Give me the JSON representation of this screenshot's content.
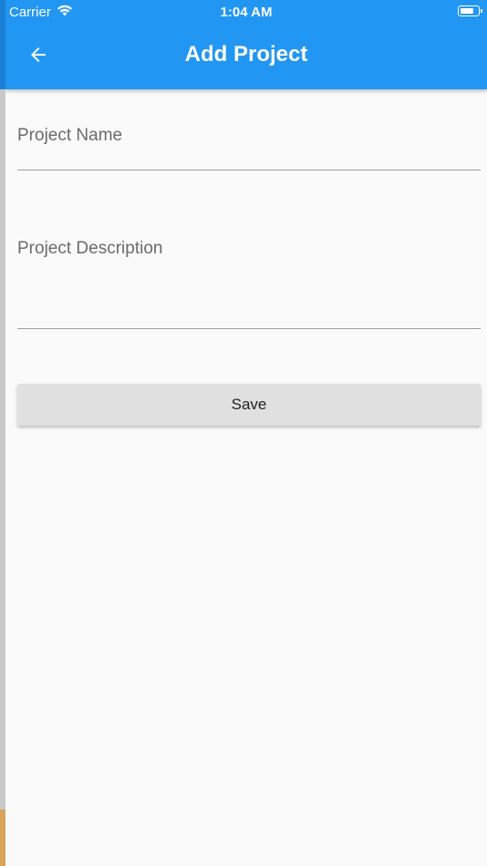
{
  "status_bar": {
    "carrier": "Carrier",
    "time": "1:04 AM",
    "wifi_icon": "wifi-icon",
    "battery_icon": "battery-icon"
  },
  "app_bar": {
    "title": "Add Project",
    "back_icon": "arrow-left-icon",
    "color": "#2196f3"
  },
  "form": {
    "project_name": {
      "label": "Project Name",
      "value": ""
    },
    "project_description": {
      "label": "Project Description",
      "value": ""
    },
    "save_label": "Save"
  }
}
